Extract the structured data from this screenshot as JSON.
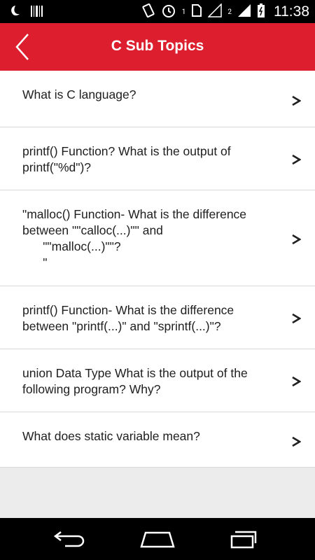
{
  "status_bar": {
    "time": "11:38",
    "sim_label": "1",
    "network_label": "2"
  },
  "header": {
    "title": "C Sub Topics"
  },
  "topics": [
    {
      "label": "What is C language?"
    },
    {
      "label": "printf() Function? What is the output of printf(\"%d\")?"
    },
    {
      "label": "\"malloc() Function- What is the difference between \"\"calloc(...)\"\" and\n      \"\"malloc(...)\"\"?\n      \""
    },
    {
      "label": "printf() Function- What is the difference between \"printf(...)\" and \"sprintf(...)\"?"
    },
    {
      "label": "union Data Type What is the output of the following program? Why?"
    },
    {
      "label": "What does static variable mean?"
    }
  ],
  "colors": {
    "appbar": "#dc1e2e",
    "chevron": "#202020"
  }
}
